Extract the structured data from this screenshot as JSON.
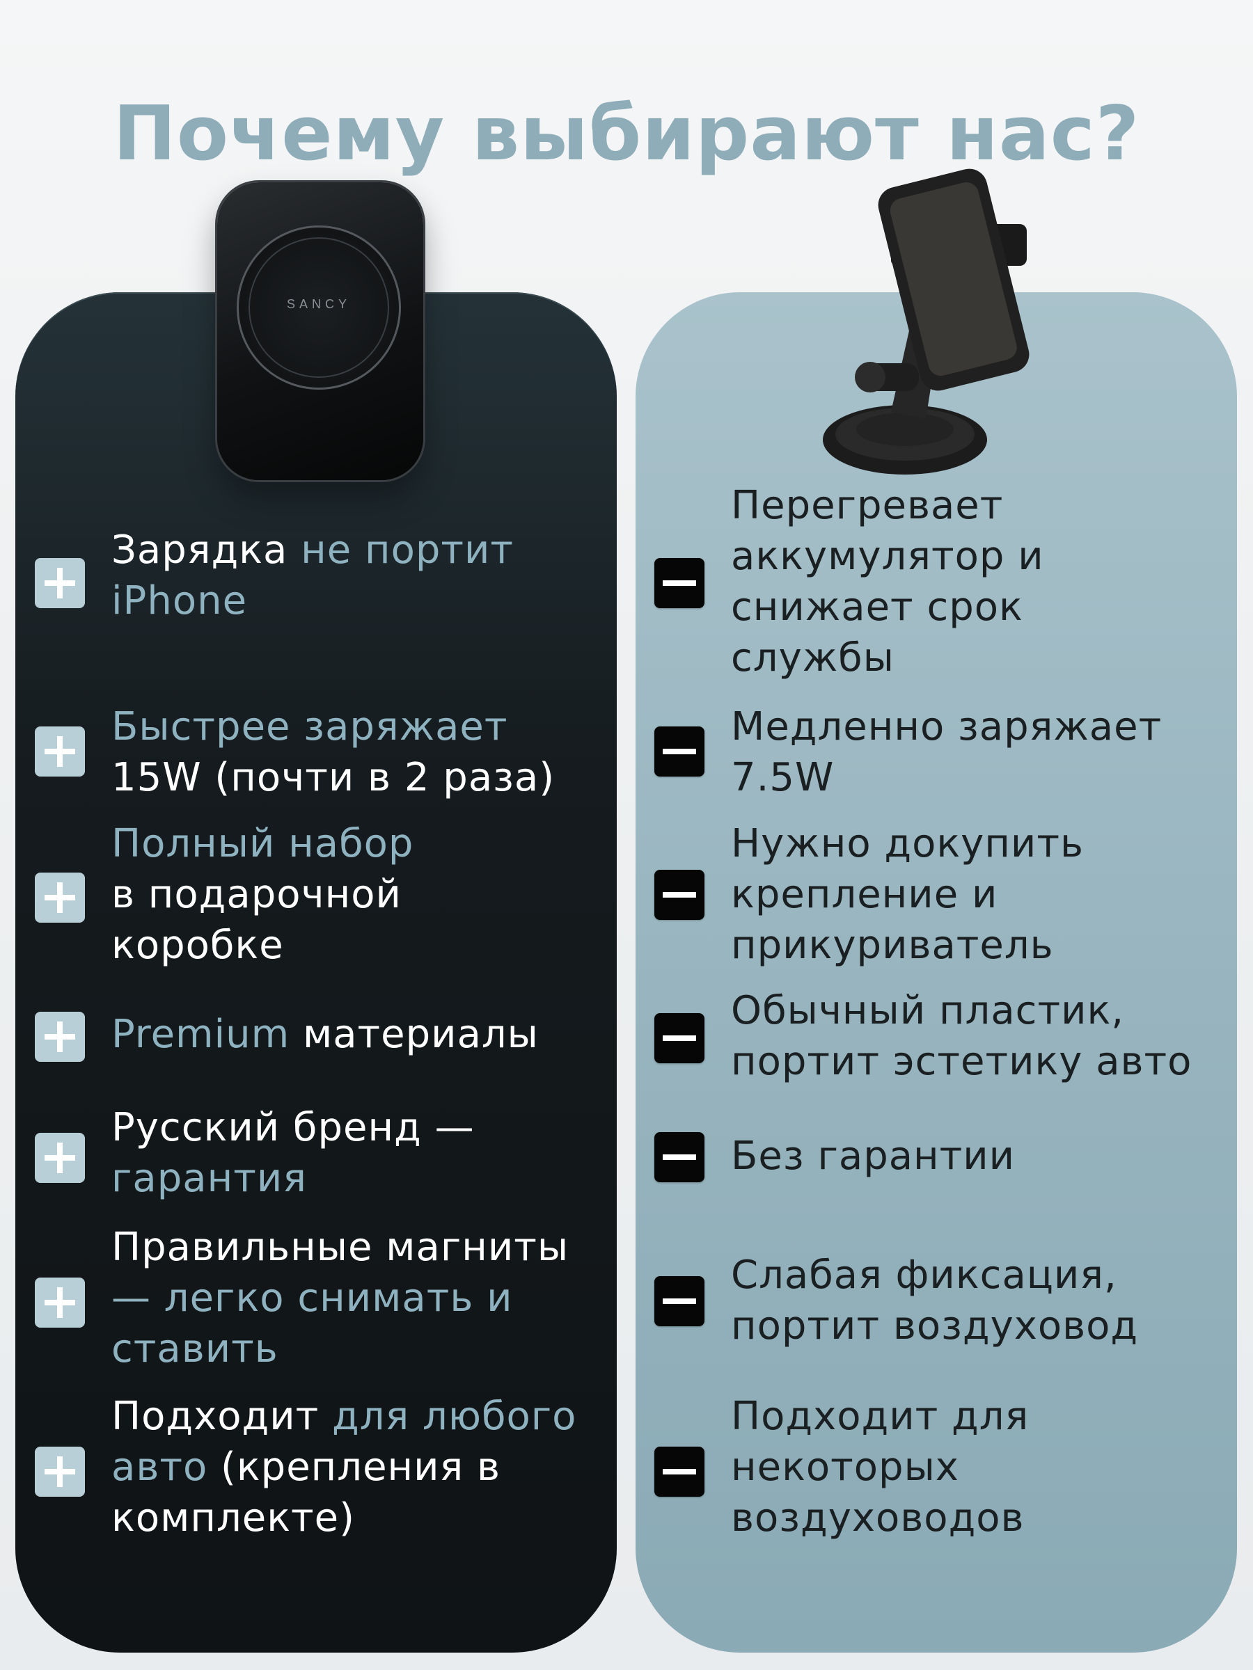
{
  "title": "Почему выбирают нас?",
  "brand": "SANCY",
  "colors": {
    "title": "#8fadb9",
    "accent": "#8fb2c0",
    "panel_left": "#151b1e",
    "panel_right": "#9ab6c0",
    "plus_badge": "#b9cfd8",
    "minus_badge": "#060606"
  },
  "icons": {
    "plus": "plus-icon",
    "minus": "minus-icon"
  },
  "pros": [
    {
      "a": "Зарядка ",
      "b": "не портит",
      "c": "",
      "d": "iPhone",
      "e": ""
    },
    {
      "a": "",
      "b": "Быстрее заряжает",
      "c": "",
      "d": "",
      "e": "15W (почти в 2 раза)"
    },
    {
      "a": "",
      "b": "Полный набор",
      "c": "",
      "d": "",
      "e": "в подарочной коробке"
    },
    {
      "a": "",
      "b": "Premium",
      "c": " материалы",
      "d": "",
      "e": ""
    },
    {
      "a": "Русский бренд — ",
      "b": "гарантия",
      "c": "",
      "d": "",
      "e": ""
    },
    {
      "a": "Правильные магниты ",
      "b": "— легко снимать и ставить",
      "c": "",
      "d": "",
      "e": ""
    },
    {
      "a": "Подходит ",
      "b": "для любого авто",
      "c": " (крепления в комплекте)",
      "d": "",
      "e": ""
    }
  ],
  "cons": [
    "Перегревает аккумулятор и снижает срок службы",
    "Медленно заряжает 7.5W",
    "Нужно докупить крепление и прикуриватель",
    "Обычный пластик, портит эстетику авто",
    "Без гарантии",
    "Слабая фиксация, портит воздуховод",
    "Подходит для некоторых воздуховодов"
  ]
}
